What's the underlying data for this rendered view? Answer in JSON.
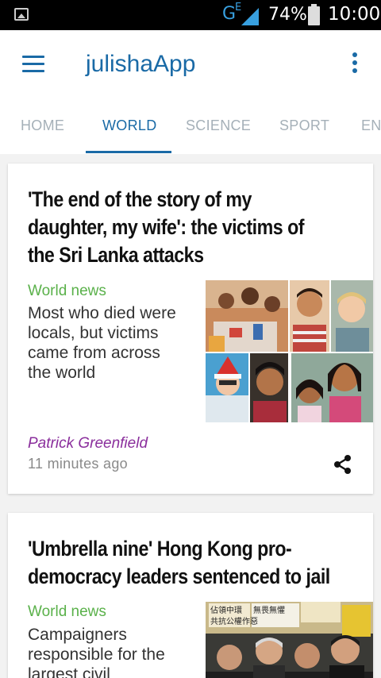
{
  "status_bar": {
    "network_label": "G",
    "network_sub": "E",
    "battery_percent": "74%",
    "time": "10:00",
    "icons": [
      "image-notification-icon",
      "signal-icon",
      "battery-icon"
    ]
  },
  "app_bar": {
    "title": "julishaApp",
    "menu_icon": "hamburger-menu-icon",
    "overflow_icon": "overflow-menu-icon"
  },
  "tabs": [
    {
      "label": "HOME",
      "active": false
    },
    {
      "label": "WORLD",
      "active": true
    },
    {
      "label": "SCIENCE",
      "active": false
    },
    {
      "label": "SPORT",
      "active": false
    },
    {
      "label": "EN",
      "active": false
    }
  ],
  "articles": [
    {
      "headline_lines": [
        "'The end of the story of my",
        "daughter, my wife': the victims of",
        "the Sri Lanka attacks"
      ],
      "section": "World news",
      "standfirst_lines": [
        "Most who died were",
        "locals, but victims",
        "came from across",
        "the world"
      ],
      "author": "Patrick Greenfield",
      "timestamp": "11 minutes ago",
      "share_icon": "share-icon",
      "image": "victims-photo-collage"
    },
    {
      "headline_lines": [
        "'Umbrella nine' Hong Kong pro-",
        "democracy leaders sentenced to jail"
      ],
      "section": "World news",
      "standfirst_lines": [
        "Campaigners",
        "responsible for the",
        "largest civil"
      ],
      "image": "protest-photo",
      "image_signs": [
        "佔領中環",
        "無畏無懼",
        "共抗公權作惡"
      ]
    }
  ],
  "colors": {
    "brand": "#1a6aa6",
    "section": "#5ab14a",
    "author": "#8a2e9c",
    "tab_inactive": "#a5b0b8",
    "status_bar": "#000000",
    "background": "#f2f2f2"
  }
}
